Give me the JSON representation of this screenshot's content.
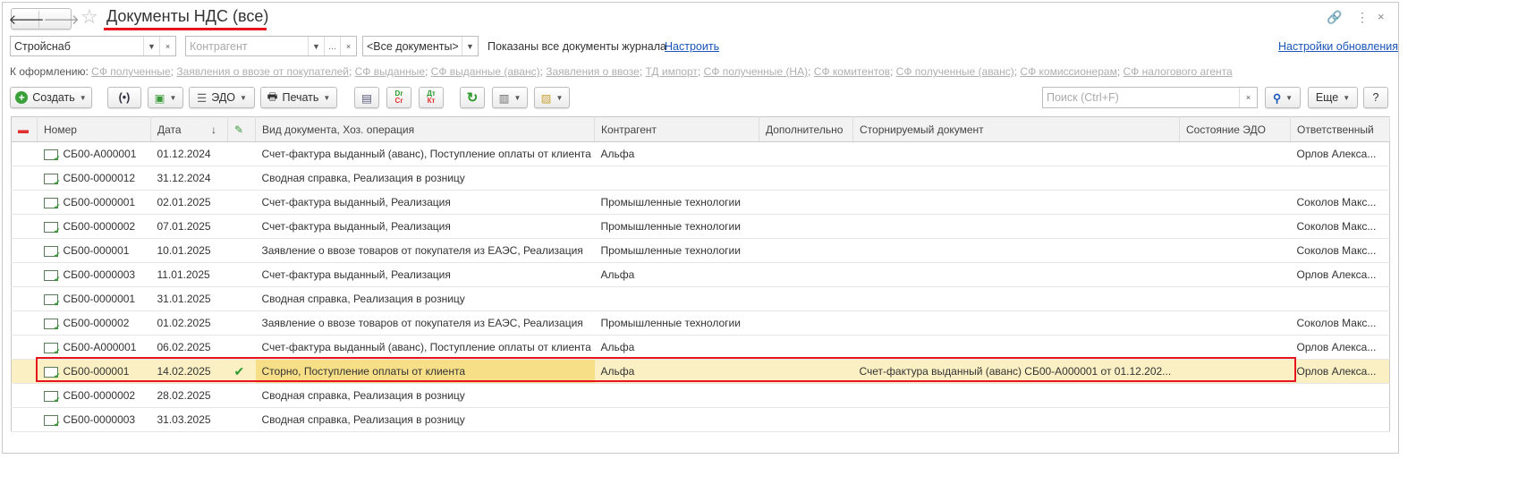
{
  "title": "Документы НДС (все)",
  "filters": {
    "organization": "Стройснаб",
    "counterparty_placeholder": "Контрагент",
    "doc_type": "<Все документы>",
    "status_text": "Показаны все документы журнала",
    "configure_link": "Настроить",
    "update_settings_link": "Настройки обновления"
  },
  "to_process": {
    "label": "К оформлению:",
    "links": [
      "СФ полученные",
      "Заявления о ввозе от покупателей",
      "СФ выданные",
      "СФ выданные (аванс)",
      "Заявления о ввозе",
      "ТД импорт",
      "СФ полученные (НА)",
      "СФ комитентов",
      "СФ полученные (аванс)",
      "СФ комиссионерам",
      "СФ налогового агента"
    ]
  },
  "toolbar": {
    "create": "Создать",
    "edo": "ЭДО",
    "print": "Печать",
    "dr": "Dr",
    "cr": "Cr",
    "dt": "Дт",
    "kt": "Кт",
    "search_placeholder": "Поиск (Ctrl+F)",
    "more": "Еще",
    "help": "?"
  },
  "columns": [
    "Номер",
    "Дата",
    "Вид документа, Хоз. операция",
    "Контрагент",
    "Дополнительно",
    "Сторнируемый документ",
    "Состояние ЭДО",
    "Ответственный"
  ],
  "rows": [
    [
      "СБ00-А000001",
      "01.12.2024",
      "Счет-фактура выданный (аванс), Поступление оплаты от клиента",
      "Альфа",
      "",
      "",
      "",
      "Орлов Алекса..."
    ],
    [
      "СБ00-0000012",
      "31.12.2024",
      "Сводная справка, Реализация в розницу",
      "",
      "",
      "",
      "",
      ""
    ],
    [
      "СБ00-0000001",
      "02.01.2025",
      "Счет-фактура выданный, Реализация",
      "Промышленные технологии",
      "",
      "",
      "",
      "Соколов Макс..."
    ],
    [
      "СБ00-0000002",
      "07.01.2025",
      "Счет-фактура выданный, Реализация",
      "Промышленные технологии",
      "",
      "",
      "",
      "Соколов Макс..."
    ],
    [
      "СБ00-000001",
      "10.01.2025",
      "Заявление о ввозе товаров от покупателя из ЕАЭС, Реализация",
      "Промышленные технологии",
      "",
      "",
      "",
      "Соколов Макс..."
    ],
    [
      "СБ00-0000003",
      "11.01.2025",
      "Счет-фактура выданный, Реализация",
      "Альфа",
      "",
      "",
      "",
      "Орлов Алекса..."
    ],
    [
      "СБ00-0000001",
      "31.01.2025",
      "Сводная справка, Реализация в розницу",
      "",
      "",
      "",
      "",
      ""
    ],
    [
      "СБ00-000002",
      "01.02.2025",
      "Заявление о ввозе товаров от покупателя из ЕАЭС, Реализация",
      "Промышленные технологии",
      "",
      "",
      "",
      "Соколов Макс..."
    ],
    [
      "СБ00-А000001",
      "06.02.2025",
      "Счет-фактура выданный (аванс), Поступление оплаты от клиента",
      "Альфа",
      "",
      "",
      "",
      "Орлов Алекса..."
    ],
    [
      "СБ00-000001",
      "14.02.2025",
      "Сторно, Поступление оплаты от клиента",
      "Альфа",
      "",
      "Счет-фактура выданный (аванс) СБ00-А000001 от 01.12.202...",
      "",
      "Орлов Алекса..."
    ],
    [
      "СБ00-0000002",
      "28.02.2025",
      "Сводная справка, Реализация в розницу",
      "",
      "",
      "",
      "",
      ""
    ],
    [
      "СБ00-0000003",
      "31.03.2025",
      "Сводная справка, Реализация в розницу",
      "",
      "",
      "",
      "",
      ""
    ]
  ],
  "selected_row": 9,
  "checked_row": 9,
  "colors": {
    "highlight": "#e8141d",
    "selected": "#fbf0c4",
    "link": "#1a56b8"
  }
}
